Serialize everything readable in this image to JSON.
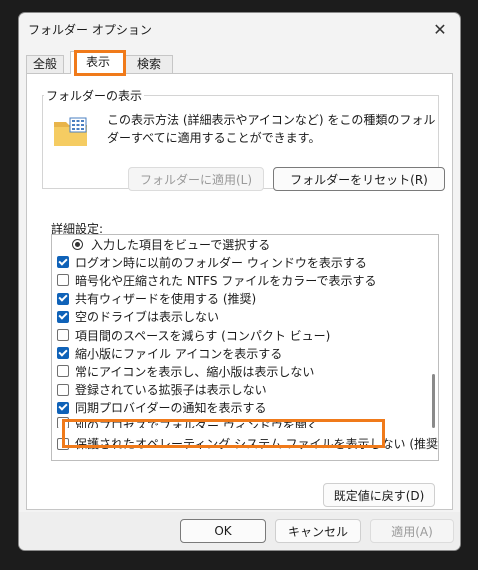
{
  "window": {
    "title": "フォルダー オプション",
    "close_glyph": "✕"
  },
  "tabs": [
    {
      "label": "全般",
      "active": false
    },
    {
      "label": "表示",
      "active": true
    },
    {
      "label": "検索",
      "active": false
    }
  ],
  "folder_views": {
    "group_label": "フォルダーの表示",
    "description": "この表示方法 (詳細表示やアイコンなど) をこの種類のフォルダーすべてに適用することができます。",
    "apply_button": "フォルダーに適用(L)",
    "apply_enabled": false,
    "reset_button": "フォルダーをリセット(R)"
  },
  "advanced": {
    "label": "詳細設定:",
    "items": [
      {
        "type": "radio",
        "label": "入力した項目をビューで選択する",
        "checked": true
      },
      {
        "type": "checkbox",
        "label": "ログオン時に以前のフォルダー ウィンドウを表示する",
        "checked": true
      },
      {
        "type": "checkbox",
        "label": "暗号化や圧縮された NTFS ファイルをカラーで表示する",
        "checked": false
      },
      {
        "type": "checkbox",
        "label": "共有ウィザードを使用する (推奨)",
        "checked": true
      },
      {
        "type": "checkbox",
        "label": "空のドライブは表示しない",
        "checked": true
      },
      {
        "type": "checkbox",
        "label": "項目間のスペースを減らす (コンパクト ビュー)",
        "checked": false
      },
      {
        "type": "checkbox",
        "label": "縮小版にファイル アイコンを表示する",
        "checked": true
      },
      {
        "type": "checkbox",
        "label": "常にアイコンを表示し、縮小版は表示しない",
        "checked": false
      },
      {
        "type": "checkbox",
        "label": "登録されている拡張子は表示しない",
        "checked": false
      },
      {
        "type": "checkbox",
        "label": "同期プロバイダーの通知を表示する",
        "checked": true
      },
      {
        "type": "checkbox",
        "label": "別のプロセスでフォルダー ウィンドウを開く",
        "checked": false
      },
      {
        "type": "checkbox",
        "label": "保護されたオペレーティング システム ファイルを表示しない (推奨)",
        "checked": false
      }
    ],
    "restore_defaults_button": "既定値に戻す(D)"
  },
  "footer": {
    "ok": "OK",
    "cancel": "キャンセル",
    "apply": "適用(A)",
    "apply_enabled": false
  },
  "colors": {
    "highlight": "#f07a1a",
    "checkbox_checked": "#0f62b8"
  }
}
